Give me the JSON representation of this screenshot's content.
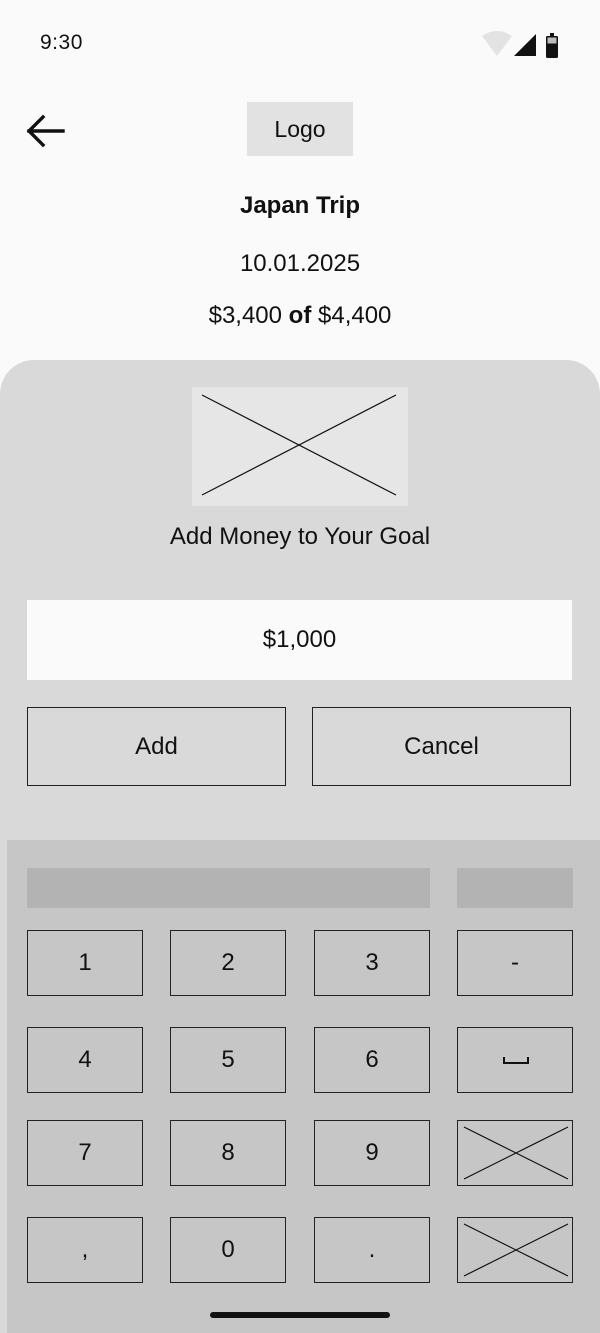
{
  "status_bar": {
    "time": "9:30",
    "icons": [
      "wifi-icon",
      "signal-icon",
      "battery-icon"
    ]
  },
  "header": {
    "back_icon": "arrow-left-icon",
    "logo_label": "Logo"
  },
  "goal": {
    "title": "Japan Trip",
    "date": "10.01.2025",
    "saved": "$3,400",
    "of_word": "of",
    "target": "$4,400"
  },
  "sheet": {
    "image": "image-placeholder",
    "title": "Add Money to Your Goal",
    "amount_value": "$1,000",
    "add_label": "Add",
    "cancel_label": "Cancel"
  },
  "keyboard": {
    "keys": [
      "1",
      "2",
      "3",
      "-",
      "4",
      "5",
      "6",
      "space-icon",
      "7",
      "8",
      "9",
      "placeholder-key",
      ",",
      "0",
      ".",
      "placeholder-key"
    ]
  },
  "colors": {
    "page_bg": "#fafafa",
    "sheet_bg": "#d9d9d9",
    "keyboard_bg": "#c6c6c6",
    "logo_bg": "#e2e2e2",
    "suggest_bg": "#b3b3b3"
  }
}
